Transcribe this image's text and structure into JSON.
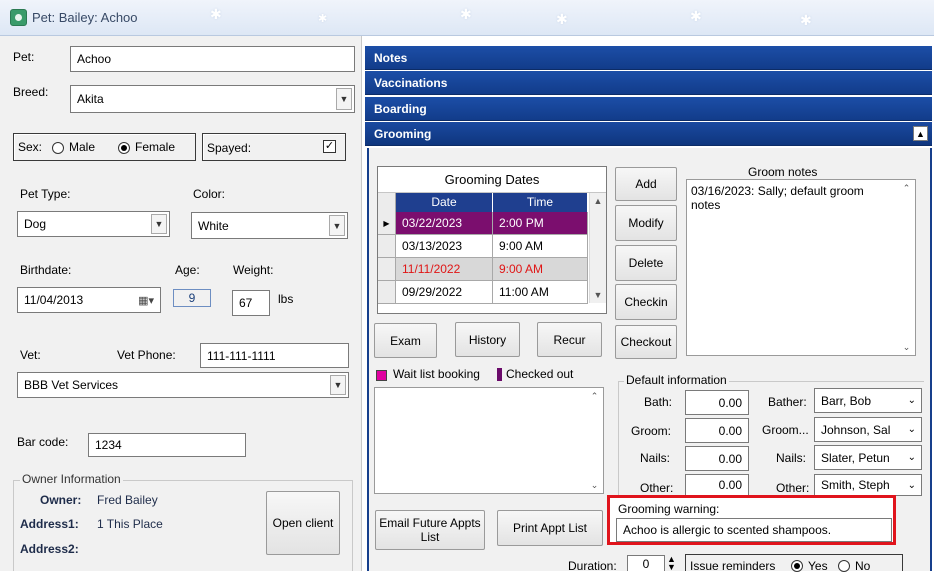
{
  "window": {
    "title": "Pet: Bailey: Achoo"
  },
  "left": {
    "pet_label": "Pet:",
    "pet_value": "Achoo",
    "breed_label": "Breed:",
    "breed_value": "Akita",
    "sex_label": "Sex:",
    "sex_male": "Male",
    "sex_female": "Female",
    "sex_selected": "Female",
    "spayed_label": "Spayed:",
    "spayed_checked": true,
    "pet_type_label": "Pet Type:",
    "pet_type_value": "Dog",
    "color_label": "Color:",
    "color_value": "White",
    "birthdate_label": "Birthdate:",
    "birthdate_value": "11/04/2013",
    "age_label": "Age:",
    "age_value": "9",
    "weight_label": "Weight:",
    "weight_value": "67",
    "weight_unit": "lbs",
    "vet_label": "Vet:",
    "vet_phone_label": "Vet Phone:",
    "vet_phone_value": "111-111-1111",
    "vet_value": "BBB Vet Services",
    "barcode_label": "Bar code:",
    "barcode_value": "1234",
    "owner_group_label": "Owner Information",
    "owner_label": "Owner:",
    "owner_value": "Fred Bailey",
    "address1_label": "Address1:",
    "address1_value": "1 This Place",
    "address2_label": "Address2:",
    "open_client_label": "Open client"
  },
  "sections": {
    "notes": "Notes",
    "vaccinations": "Vaccinations",
    "boarding": "Boarding",
    "grooming": "Grooming"
  },
  "grooming": {
    "dates_title": "Grooming Dates",
    "col_date": "Date",
    "col_time": "Time",
    "rows": [
      {
        "date": "03/22/2023",
        "time": "2:00 PM",
        "style": "selected"
      },
      {
        "date": "03/13/2023",
        "time": "9:00 AM",
        "style": "normal"
      },
      {
        "date": "11/11/2022",
        "time": "9:00 AM",
        "style": "checked-out"
      },
      {
        "date": "09/29/2022",
        "time": "11:00 AM",
        "style": "normal"
      }
    ],
    "buttons": {
      "add": "Add",
      "modify": "Modify",
      "delete": "Delete",
      "checkin": "Checkin",
      "checkout": "Checkout",
      "exam": "Exam",
      "history": "History",
      "recur": "Recur",
      "email_future": "Email Future Appts List",
      "print_appt": "Print Appt List"
    },
    "groom_notes_label": "Groom notes",
    "groom_notes_text": "03/16/2023: Sally; default groom notes",
    "legend_wait": "Wait list booking",
    "legend_checked": "Checked out",
    "legend_wait_color": "#e000a0",
    "legend_checked_color": "#6a0a6a",
    "default_info_label": "Default information",
    "bath_label": "Bath:",
    "bath_value": "0.00",
    "groom_label": "Groom:",
    "groom_value": "0.00",
    "nails_label": "Nails:",
    "nails_value": "0.00",
    "other_label": "Other:",
    "other_value": "0.00",
    "bather_label": "Bather:",
    "bather_value": "Barr, Bob",
    "groomer_label": "Groom...",
    "groomer_value": "Johnson, Sal",
    "nails_staff_label": "Nails:",
    "nails_staff_value": "Slater, Petun",
    "other_staff_label": "Other:",
    "other_staff_value": "Smith, Steph",
    "warning_label": "Grooming warning:",
    "warning_value": "Achoo is allergic to scented shampoos.",
    "duration_label": "Duration:",
    "duration_value": "0",
    "issue_reminders_label": "Issue reminders",
    "yes_label": "Yes",
    "no_label": "No",
    "reminders_selected": "Yes"
  },
  "colors": {
    "section_bar": "#173f8e",
    "selected_row": "#7b0e6e",
    "checked_out_text": "#e01515",
    "highlight_border": "#e0141c"
  }
}
